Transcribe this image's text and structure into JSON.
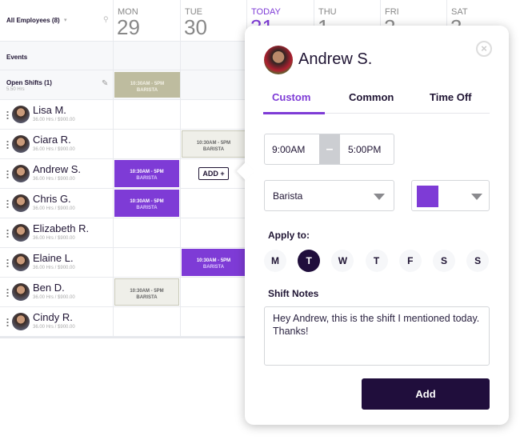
{
  "schedule": {
    "filter_label": "All Employees (8)",
    "days": [
      {
        "day": "MON",
        "num": "29"
      },
      {
        "day": "TUE",
        "num": "30"
      },
      {
        "day": "TODAY",
        "num": "31"
      },
      {
        "day": "THU",
        "num": "1"
      },
      {
        "day": "FRI",
        "num": "2"
      },
      {
        "day": "SAT",
        "num": "3"
      }
    ],
    "events_label": "Events",
    "open_shifts": {
      "label": "Open Shifts (1)",
      "hours": "5.50 Hrs",
      "shift": {
        "time": "10:30AM - 5PM",
        "role": "BARISTA"
      }
    },
    "employees": [
      {
        "name": "Lisa M.",
        "sub": "36.00 Hrs / $900.00"
      },
      {
        "name": "Ciara R.",
        "sub": "36.00 Hrs / $900.00",
        "shift": {
          "day": 1,
          "style": "outline",
          "time": "10:30AM - 5PM",
          "role": "BARISTA"
        }
      },
      {
        "name": "Andrew S.",
        "sub": "36.00 Hrs / $900.00",
        "shift": {
          "day": 0,
          "style": "purple",
          "time": "10:30AM - 5PM",
          "role": "BARISTA"
        }
      },
      {
        "name": "Chris G.",
        "sub": "36.00 Hrs / $900.00",
        "shift": {
          "day": 0,
          "style": "purple",
          "time": "10:30AM - 5PM",
          "role": "BARISTA"
        }
      },
      {
        "name": "Elizabeth R.",
        "sub": "36.00 Hrs / $900.00"
      },
      {
        "name": "Elaine L.",
        "sub": "36.00 Hrs / $900.00",
        "shift": {
          "day": 1,
          "style": "purple",
          "time": "10:30AM - 5PM",
          "role": "BARISTA"
        }
      },
      {
        "name": "Ben D.",
        "sub": "36.00 Hrs / $900.00",
        "shift": {
          "day": 0,
          "style": "outline",
          "time": "10:30AM - 5PM",
          "role": "BARISTA"
        }
      },
      {
        "name": "Cindy R.",
        "sub": "36.00 Hrs / $900.00"
      }
    ],
    "add_label": "ADD +"
  },
  "popup": {
    "name": "Andrew S.",
    "tabs": [
      {
        "label": "Custom",
        "active": true
      },
      {
        "label": "Common"
      },
      {
        "label": "Time Off"
      }
    ],
    "start": "9:00AM",
    "separator": "–",
    "end": "5:00PM",
    "role": "Barista",
    "color": "#7e3bd6",
    "apply_label": "Apply to:",
    "days": [
      {
        "l": "M"
      },
      {
        "l": "T",
        "selected": true
      },
      {
        "l": "W"
      },
      {
        "l": "T"
      },
      {
        "l": "F"
      },
      {
        "l": "S"
      },
      {
        "l": "S"
      }
    ],
    "notes_label": "Shift Notes",
    "notes": "Hey Andrew, this is the shift I mentioned today. Thanks!",
    "add_button": "Add"
  },
  "colors": {
    "accent": "#7e3bd6",
    "dark": "#200e3c"
  }
}
